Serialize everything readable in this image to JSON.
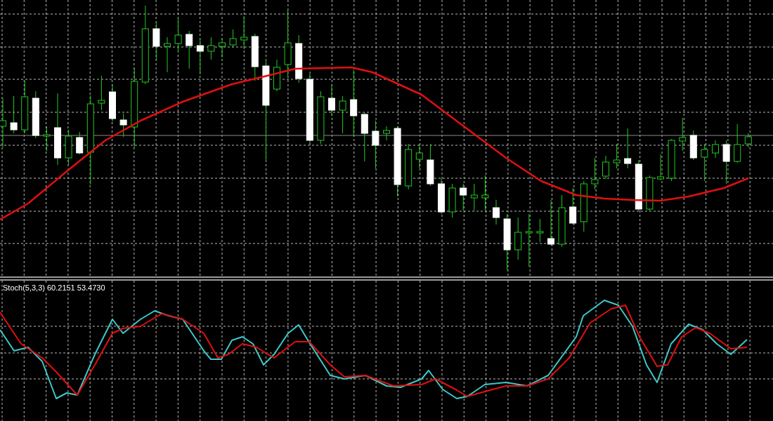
{
  "indicator_panel": {
    "label": "Stoch(5,3,3) 60.2151 53.4730"
  }
}
